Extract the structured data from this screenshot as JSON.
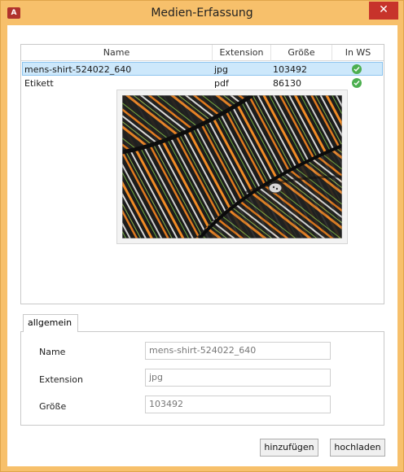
{
  "window": {
    "title": "Medien-Erfassung",
    "app_icon_text": "A",
    "close_glyph": "✕"
  },
  "table": {
    "columns": [
      "Name",
      "Extension",
      "Größe",
      "In WS"
    ],
    "rows": [
      {
        "name": "mens-shirt-524022_640",
        "extension": "jpg",
        "size": "103492",
        "in_ws": "check-icon"
      },
      {
        "name": "Etikett",
        "extension": "pdf",
        "size": "86130",
        "in_ws": "check-icon"
      }
    ]
  },
  "preview": {
    "image": "striped-shirt-image"
  },
  "tabs": {
    "general": "allgemein"
  },
  "details": {
    "name_label": "Name",
    "name_value": "mens-shirt-524022_640",
    "extension_label": "Extension",
    "extension_value": "jpg",
    "size_label": "Größe",
    "size_value": "103492"
  },
  "buttons": {
    "add": "hinzufügen",
    "upload": "hochladen"
  },
  "colors": {
    "titlebar": "#f7c06b",
    "close": "#c7332b",
    "selection": "#cde8fb",
    "ok": "#4caf50"
  }
}
